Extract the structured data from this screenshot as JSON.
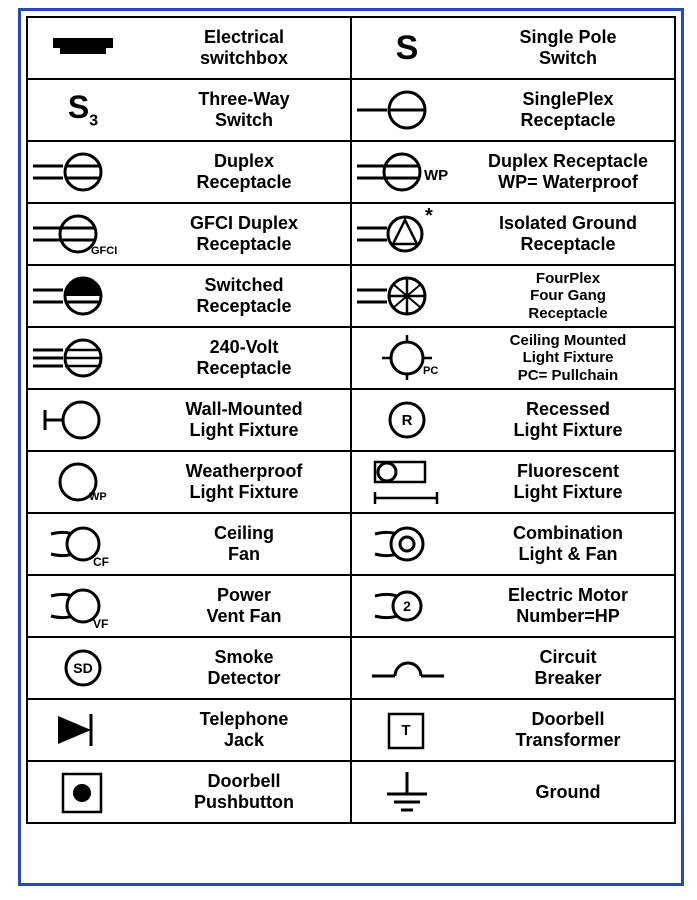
{
  "rows": [
    [
      {
        "icon": "switchbox",
        "label": "Electrical\nswitchbox"
      },
      {
        "icon": "s",
        "label": "Single Pole\nSwitch"
      }
    ],
    [
      {
        "icon": "s3",
        "label": "Three-Way\nSwitch"
      },
      {
        "icon": "singleplex",
        "label": "SinglePlex\nReceptacle"
      }
    ],
    [
      {
        "icon": "duplex",
        "label": "Duplex\nReceptacle"
      },
      {
        "icon": "duplex-wp",
        "label": "Duplex Receptacle\nWP= Waterproof"
      }
    ],
    [
      {
        "icon": "gfci",
        "label": "GFCI Duplex\nReceptacle"
      },
      {
        "icon": "iso-ground",
        "label": "Isolated Ground\nReceptacle"
      }
    ],
    [
      {
        "icon": "switched",
        "label": "Switched\nReceptacle"
      },
      {
        "icon": "fourplex",
        "label": "FourPlex\nFour Gang\nReceptacle",
        "small": true
      }
    ],
    [
      {
        "icon": "240v",
        "label": "240-Volt\nReceptacle"
      },
      {
        "icon": "ceiling-pc",
        "label": "Ceiling Mounted\nLight Fixture\nPC= Pullchain",
        "small": true
      }
    ],
    [
      {
        "icon": "wall-fixture",
        "label": "Wall-Mounted\nLight Fixture"
      },
      {
        "icon": "recessed",
        "label": "Recessed\nLight Fixture"
      }
    ],
    [
      {
        "icon": "weatherproof",
        "label": "Weatherproof\nLight Fixture"
      },
      {
        "icon": "fluorescent",
        "label": "Fluorescent\nLight Fixture"
      }
    ],
    [
      {
        "icon": "ceiling-fan",
        "label": "Ceiling\nFan"
      },
      {
        "icon": "combo",
        "label": "Combination\nLight & Fan"
      }
    ],
    [
      {
        "icon": "vent-fan",
        "label": "Power\nVent Fan"
      },
      {
        "icon": "motor",
        "label": "Electric Motor\nNumber=HP"
      }
    ],
    [
      {
        "icon": "smoke",
        "label": "Smoke\nDetector"
      },
      {
        "icon": "breaker",
        "label": "Circuit\nBreaker"
      }
    ],
    [
      {
        "icon": "telephone",
        "label": "Telephone\nJack"
      },
      {
        "icon": "doorbell-t",
        "label": "Doorbell\nTransformer"
      }
    ],
    [
      {
        "icon": "pushbutton",
        "label": "Doorbell\nPushbutton"
      },
      {
        "icon": "ground",
        "label": "Ground"
      }
    ]
  ],
  "annotations": {
    "gfci_text": "GFCI",
    "wp_text": "WP",
    "cf_text": "CF",
    "vf_text": "VF",
    "sd_text": "SD",
    "r_text": "R",
    "t_text": "T",
    "pc_text": "PC",
    "s_text": "S",
    "s3_text": "S",
    "s3_sub": "3",
    "star": "*",
    "motor_num": "2"
  }
}
